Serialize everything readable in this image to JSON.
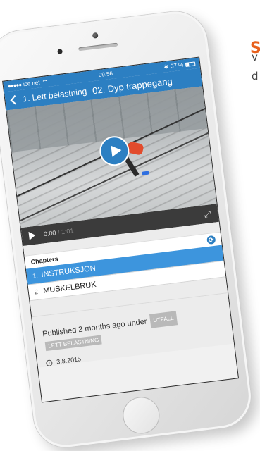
{
  "background": {
    "heading_fragment": "S",
    "line1_fragment": "v",
    "line2_fragment": "d"
  },
  "statusbar": {
    "carrier": "ice.net",
    "time": "09.56",
    "battery_text": "37 %",
    "battery_level": 0.37
  },
  "navbar": {
    "back_label": "1. Lett belastning",
    "title": "02. Dyp trappegang"
  },
  "player": {
    "current_time": "0:00",
    "separator": "/",
    "total_time": "1:01"
  },
  "chapters": {
    "header": "Chapters",
    "items": [
      {
        "number": "1.",
        "label": "INSTRUKSJON",
        "active": true
      },
      {
        "number": "2.",
        "label": "MUSKELBRUK",
        "active": false
      }
    ]
  },
  "info": {
    "published_text": "Published 2 months ago under",
    "tags": [
      "UTFALL",
      "LETT BELASTNING"
    ],
    "date": "3.8.2015"
  },
  "colors": {
    "brand_blue": "#2c7fc2",
    "active_chapter": "#3d95dd",
    "accent_orange": "#e8601c"
  }
}
